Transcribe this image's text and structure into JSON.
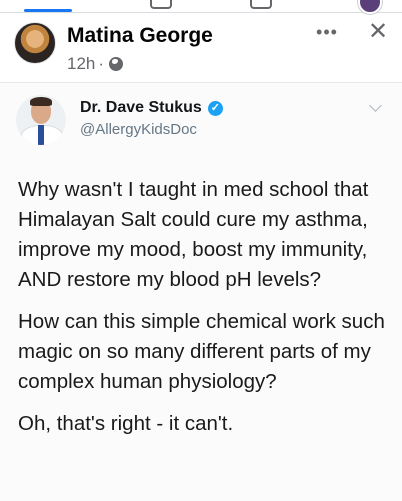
{
  "post": {
    "author_name": "Matina George",
    "time": "12h",
    "separator": "·",
    "globe_icon": "globe-icon",
    "more_icon": "more-horizontal-icon",
    "more_glyph": "•••",
    "close_icon": "close-icon",
    "close_glyph": "✕"
  },
  "tweet": {
    "name": "Dr. Dave Stukus",
    "verified_glyph": "✓",
    "handle": "@AllergyKidsDoc",
    "paragraphs": [
      "Why wasn't I taught in med school that Himalayan Salt could cure my asthma, improve my mood, boost my immunity, AND restore my blood pH levels?",
      "How can this simple chemical work such magic on so many different parts of my complex human physiology?",
      "Oh, that's right - it can't."
    ]
  },
  "colors": {
    "accent": "#1877f2",
    "verified": "#1da1f2",
    "meta_text": "#65676b"
  }
}
